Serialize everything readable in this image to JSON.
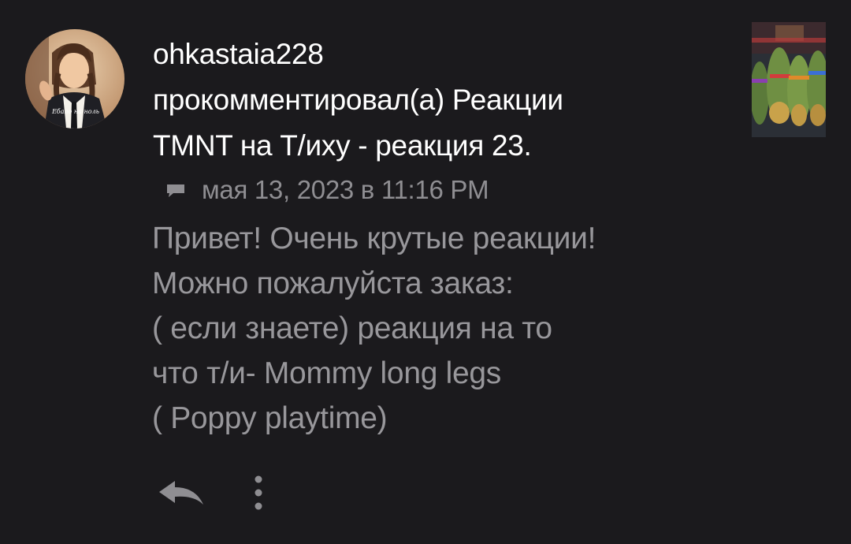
{
  "notification": {
    "username": "ohkastaia228",
    "action_line1": "прокомментировал(а) Реакции",
    "action_line2": "TMNT на Т/иху - реакция 23.",
    "timestamp": "мая 13, 2023 в 11:16 PM",
    "avatar_caption": "Ебало на ноль",
    "comment_lines": [
      "Привет! Очень крутые реакции!",
      "Можно пожалуйста заказ:",
      "( если знаете) реакция на то",
      "что т/и- Mommy long legs",
      "( Poppy playtime)"
    ]
  },
  "icons": {
    "comment": "comment-icon",
    "reply": "reply-icon",
    "more": "more-vertical-icon"
  },
  "colors": {
    "background": "#1b1a1d",
    "primary_text": "#ffffff",
    "secondary_text": "#98979b",
    "icon": "#8f8e92"
  }
}
